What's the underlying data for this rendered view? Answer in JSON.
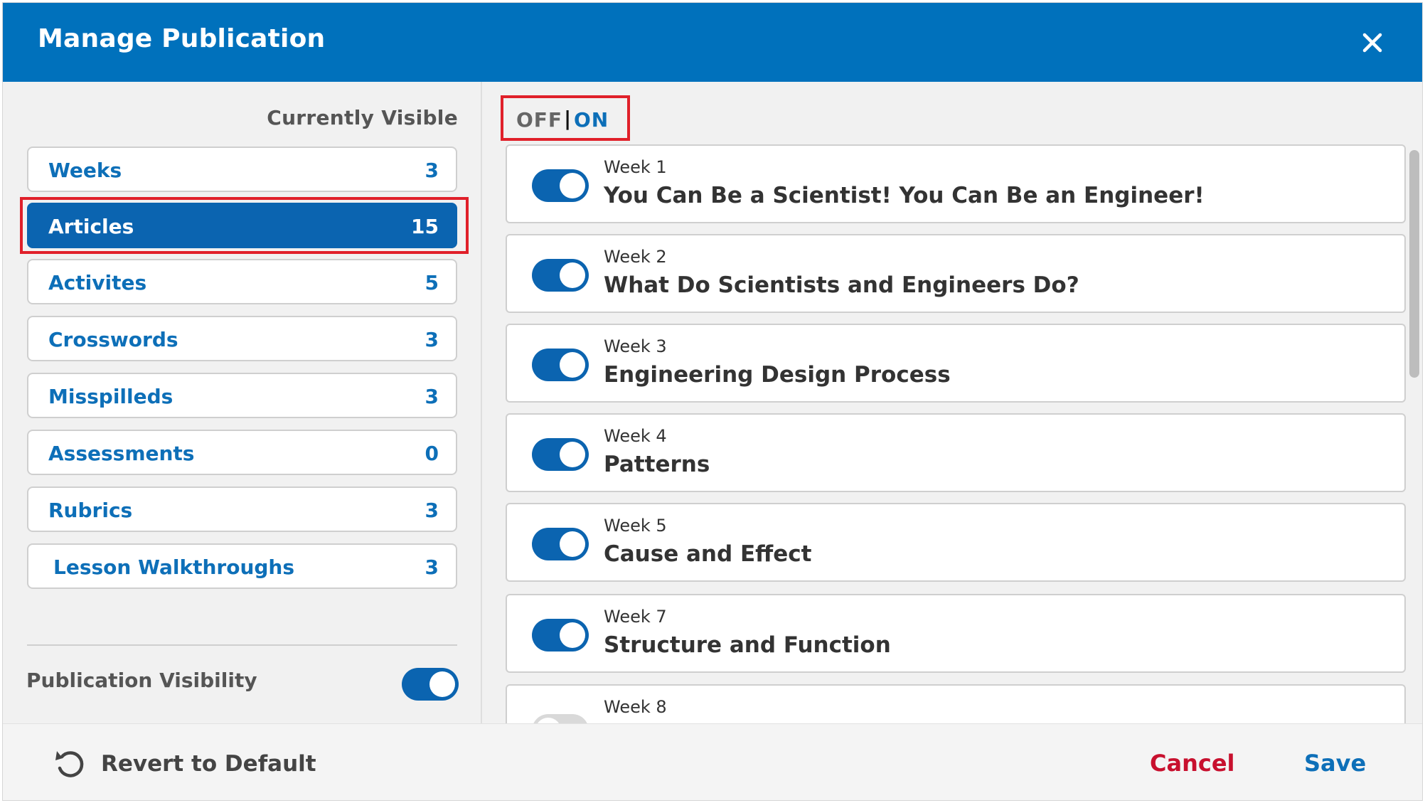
{
  "header": {
    "title": "Manage Publication",
    "close_icon": "close-icon"
  },
  "left_panel": {
    "currently_visible_label": "Currently Visible",
    "categories": [
      {
        "label": "Weeks",
        "count": "3"
      },
      {
        "label": "Articles",
        "count": "15"
      },
      {
        "label": "Activites",
        "count": "5"
      },
      {
        "label": "Crosswords",
        "count": "3"
      },
      {
        "label": "Misspilleds",
        "count": "3"
      },
      {
        "label": "Assessments",
        "count": "0"
      },
      {
        "label": "Rubrics",
        "count": "3"
      },
      {
        "label": "Lesson Walkthroughs",
        "count": "3"
      }
    ],
    "selected_index": 1,
    "publication_visibility_label": "Publication Visibility",
    "publication_visibility_on": true
  },
  "right_panel": {
    "off_label": "OFF",
    "separator": "|",
    "on_label": "ON",
    "weeks": [
      {
        "week": "Week 1",
        "title": "You Can Be a Scientist! You Can Be an Engineer!",
        "on": true
      },
      {
        "week": "Week 2",
        "title": "What Do Scientists and Engineers Do?",
        "on": true
      },
      {
        "week": "Week 3",
        "title": "Engineering Design Process",
        "on": true
      },
      {
        "week": "Week 4",
        "title": "Patterns",
        "on": true
      },
      {
        "week": "Week 5",
        "title": "Cause and Effect",
        "on": true
      },
      {
        "week": "Week 7",
        "title": "Structure and Function",
        "on": true
      },
      {
        "week": "Week 8",
        "title": "",
        "on": false
      }
    ]
  },
  "footer": {
    "revert_label": "Revert to Default",
    "revert_icon": "undo-icon",
    "cancel_label": "Cancel",
    "save_label": "Save"
  },
  "colors": {
    "header": "#0071bc",
    "selected": "#0b64b0",
    "accent_text": "#0d6fb8",
    "cancel": "#c8102e",
    "highlight": "#e0202a"
  }
}
